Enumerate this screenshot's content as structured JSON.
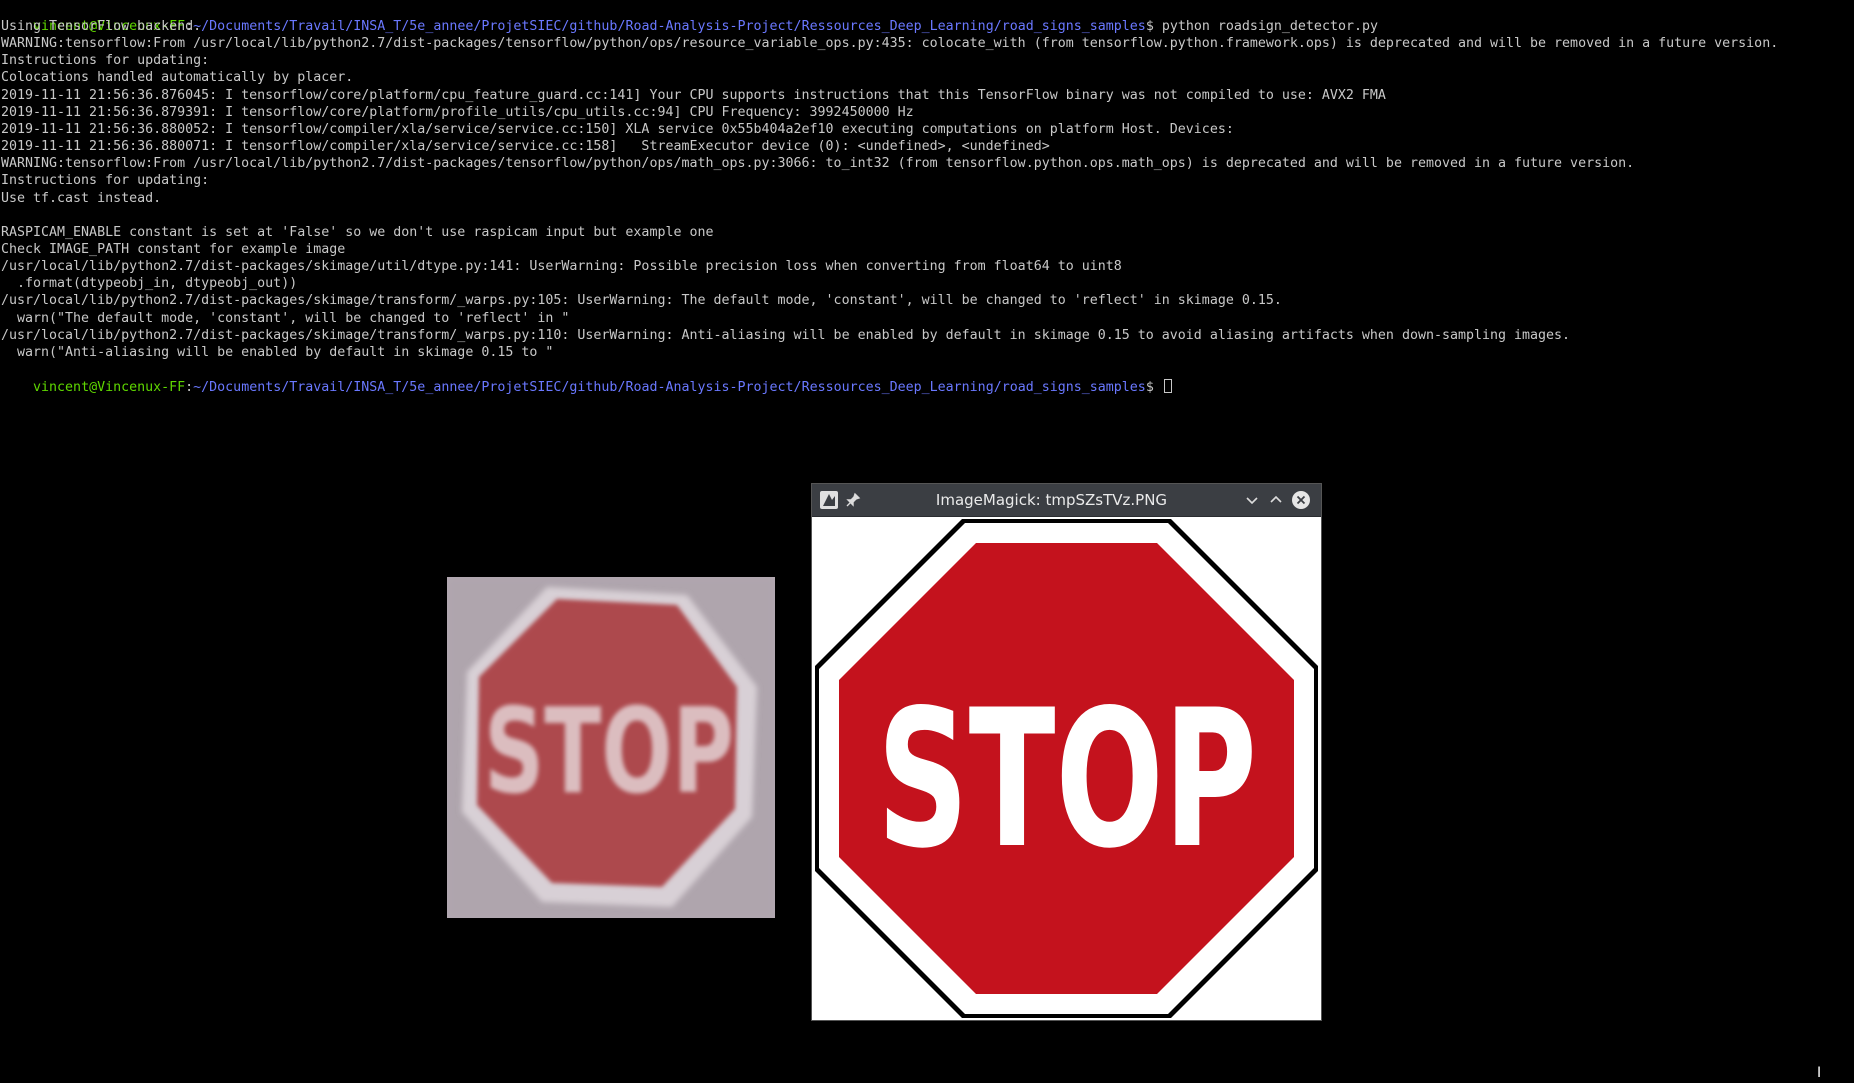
{
  "terminal": {
    "prompt_user": "vincent@Vincenux-FF",
    "prompt_path": "~/Documents/Travail/INSA_T/5e_annee/ProjetSIEC/github/Road-Analysis-Project/Ressources_Deep_Learning/road_signs_samples",
    "command": " python roadsign_detector.py",
    "lines": [
      "Using TensorFlow backend.",
      "WARNING:tensorflow:From /usr/local/lib/python2.7/dist-packages/tensorflow/python/ops/resource_variable_ops.py:435: colocate_with (from tensorflow.python.framework.ops) is deprecated and will be removed in a future version.",
      "Instructions for updating:",
      "Colocations handled automatically by placer.",
      "2019-11-11 21:56:36.876045: I tensorflow/core/platform/cpu_feature_guard.cc:141] Your CPU supports instructions that this TensorFlow binary was not compiled to use: AVX2 FMA",
      "2019-11-11 21:56:36.879391: I tensorflow/core/platform/profile_utils/cpu_utils.cc:94] CPU Frequency: 3992450000 Hz",
      "2019-11-11 21:56:36.880052: I tensorflow/compiler/xla/service/service.cc:150] XLA service 0x55b404a2ef10 executing computations on platform Host. Devices:",
      "2019-11-11 21:56:36.880071: I tensorflow/compiler/xla/service/service.cc:158]   StreamExecutor device (0): <undefined>, <undefined>",
      "WARNING:tensorflow:From /usr/local/lib/python2.7/dist-packages/tensorflow/python/ops/math_ops.py:3066: to_int32 (from tensorflow.python.ops.math_ops) is deprecated and will be removed in a future version.",
      "Instructions for updating:",
      "Use tf.cast instead.",
      "",
      "RASPICAM_ENABLE constant is set at 'False' so we don't use raspicam input but example one",
      "Check IMAGE_PATH constant for example image",
      "/usr/local/lib/python2.7/dist-packages/skimage/util/dtype.py:141: UserWarning: Possible precision loss when converting from float64 to uint8",
      "  .format(dtypeobj_in, dtypeobj_out))",
      "/usr/local/lib/python2.7/dist-packages/skimage/transform/_warps.py:105: UserWarning: The default mode, 'constant', will be changed to 'reflect' in skimage 0.15.",
      "  warn(\"The default mode, 'constant', will be changed to 'reflect' in \"",
      "/usr/local/lib/python2.7/dist-packages/skimage/transform/_warps.py:110: UserWarning: Anti-aliasing will be enabled by default in skimage 0.15 to avoid aliasing artifacts when down-sampling images.",
      "  warn(\"Anti-aliasing will be enabled by default in skimage 0.15 to \""
    ],
    "colors": {
      "background": "#000000",
      "text": "#c8c8c8",
      "prompt_user": "#5fd700",
      "prompt_path": "#6a78ff"
    }
  },
  "photo": {
    "sign_text": "STOP"
  },
  "imagemagick_window": {
    "title": "ImageMagick: tmpSZsTVz.PNG",
    "sign_text": "STOP",
    "sign_color": "#c4121d",
    "icons": [
      "imagemagick-app-icon",
      "pin-icon",
      "minimize-icon",
      "maximize-icon",
      "close-icon"
    ]
  }
}
